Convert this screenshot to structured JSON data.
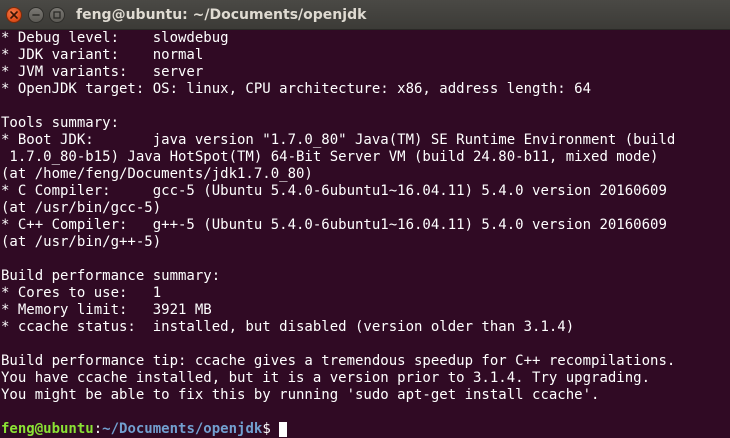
{
  "window": {
    "title": "feng@ubuntu: ~/Documents/openjdk"
  },
  "terminal": {
    "lines": [
      "* Debug level:    slowdebug",
      "* JDK variant:    normal",
      "* JVM variants:   server",
      "* OpenJDK target: OS: linux, CPU architecture: x86, address length: 64",
      "",
      "Tools summary:",
      "* Boot JDK:       java version \"1.7.0_80\" Java(TM) SE Runtime Environment (build",
      " 1.7.0_80-b15) Java HotSpot(TM) 64-Bit Server VM (build 24.80-b11, mixed mode)",
      "(at /home/feng/Documents/jdk1.7.0_80)",
      "* C Compiler:     gcc-5 (Ubuntu 5.4.0-6ubuntu1~16.04.11) 5.4.0 version 20160609",
      "(at /usr/bin/gcc-5)",
      "* C++ Compiler:   g++-5 (Ubuntu 5.4.0-6ubuntu1~16.04.11) 5.4.0 version 20160609",
      "(at /usr/bin/g++-5)",
      "",
      "Build performance summary:",
      "* Cores to use:   1",
      "* Memory limit:   3921 MB",
      "* ccache status:  installed, but disabled (version older than 3.1.4)",
      "",
      "Build performance tip: ccache gives a tremendous speedup for C++ recompilations.",
      "You have ccache installed, but it is a version prior to 3.1.4. Try upgrading.",
      "You might be able to fix this by running 'sudo apt-get install ccache'.",
      ""
    ],
    "prompt": {
      "user_host": "feng@ubuntu",
      "colon": ":",
      "path": "~/Documents/openjdk",
      "symbol": "$"
    }
  },
  "colors": {
    "background": "#300a24",
    "text": "#ffffff",
    "prompt_user": "#8ae234",
    "prompt_path": "#729fcf",
    "close_button": "#e0501c"
  },
  "icons": {
    "close": "close-icon",
    "minimize": "minimize-icon",
    "maximize": "maximize-icon"
  }
}
